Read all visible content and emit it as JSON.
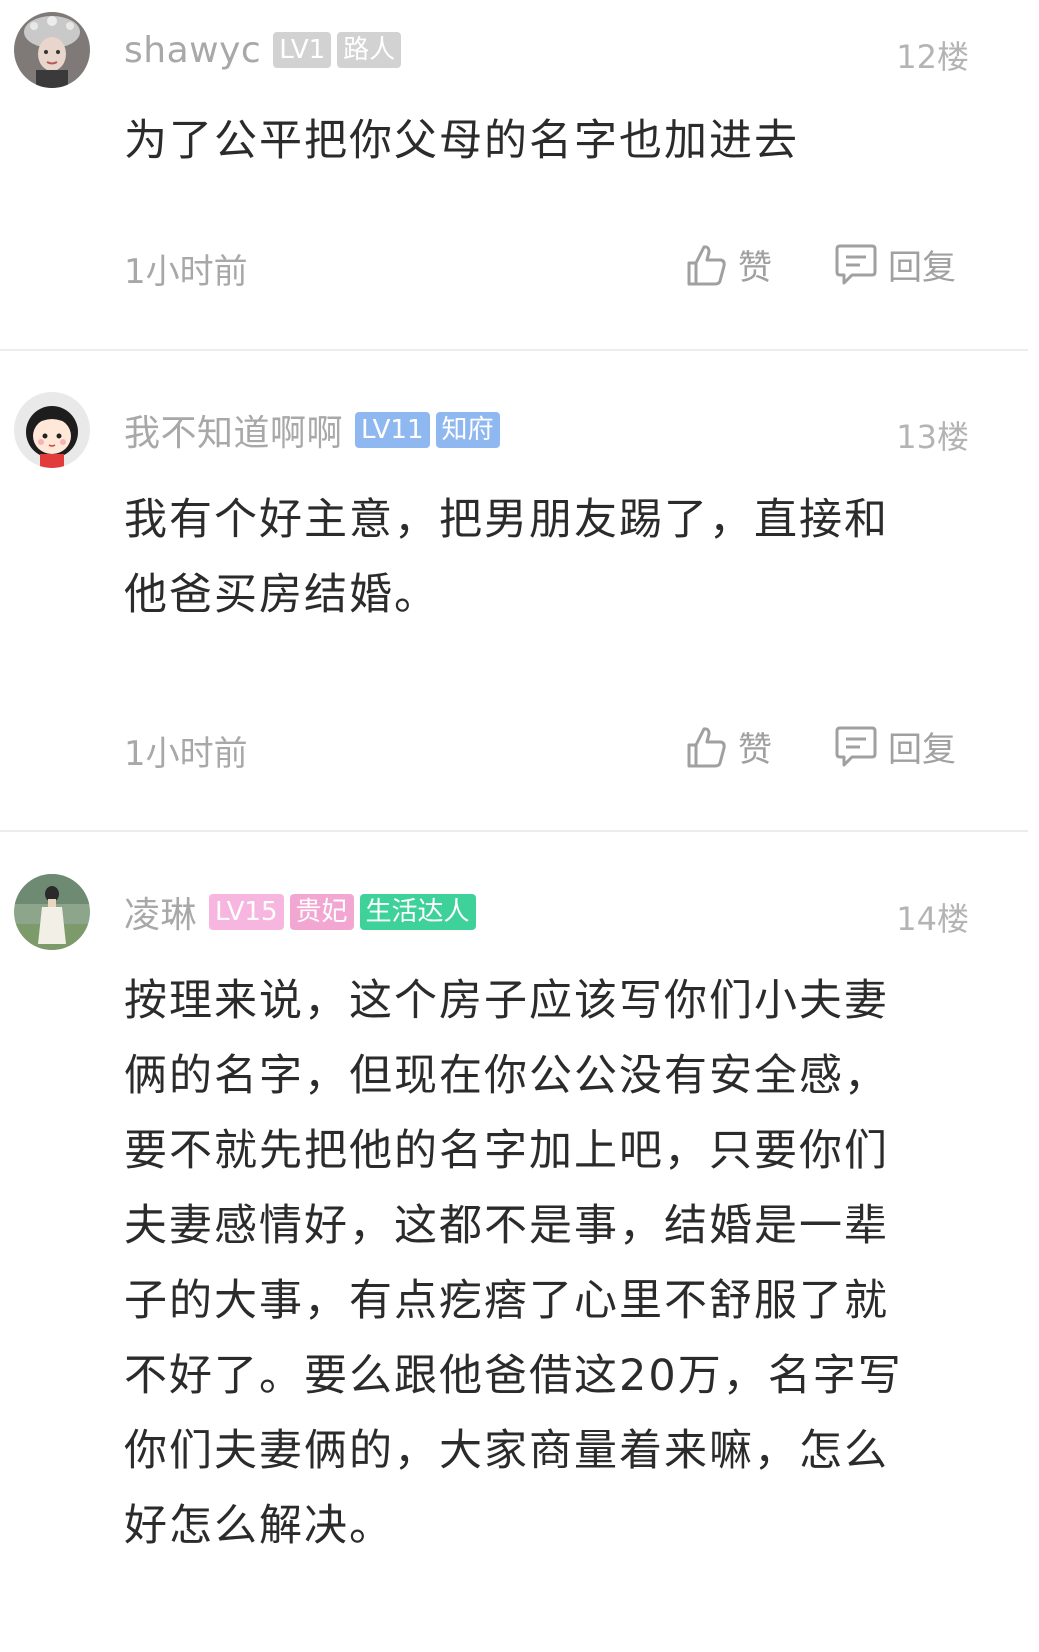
{
  "comments": [
    {
      "username": "shawyc",
      "badges": [
        {
          "text": "LV1",
          "color": "#cfcfcf"
        },
        {
          "text": "路人",
          "color": "#cfcfcf"
        }
      ],
      "floor": "12楼",
      "content": "为了公平把你父母的名字也加进去",
      "time": "1小时前",
      "like_label": "赞",
      "reply_label": "回复",
      "avatar_icon": "woman-headdress-avatar"
    },
    {
      "username": "我不知道啊啊",
      "badges": [
        {
          "text": "LV11",
          "color": "#8fb8f0"
        },
        {
          "text": "知府",
          "color": "#8fb8f0"
        }
      ],
      "floor": "13楼",
      "content": "我有个好主意，把男朋友踢了，直接和他爸买房结婚。",
      "time": "1小时前",
      "like_label": "赞",
      "reply_label": "回复",
      "avatar_icon": "cartoon-girl-avatar"
    },
    {
      "username": "凌琳",
      "badges": [
        {
          "text": "LV15",
          "color": "#f7b6df"
        },
        {
          "text": "贵妃",
          "color": "#f2a6d2"
        },
        {
          "text": "生活达人",
          "color": "#3ed29a"
        }
      ],
      "floor": "14楼",
      "content": "按理来说，这个房子应该写你们小夫妻俩的名字，但现在你公公没有安全感，要不就先把他的名字加上吧，只要你们夫妻感情好，这都不是事，结婚是一辈子的大事，有点疙瘩了心里不舒服了就不好了。要么跟他爸借这20万，名字写你们夫妻俩的，大家商量着来嘛，怎么好怎么解决。",
      "avatar_icon": "girl-in-field-avatar"
    }
  ]
}
